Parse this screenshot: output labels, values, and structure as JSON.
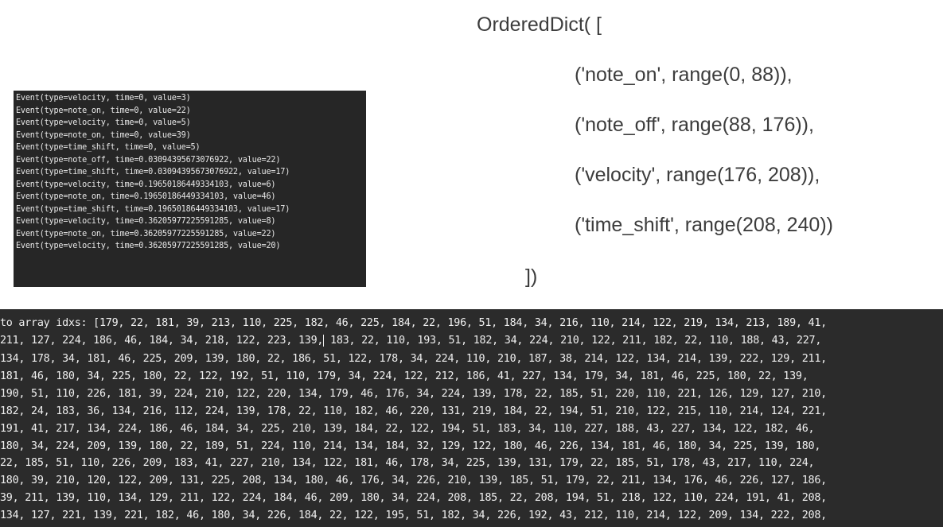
{
  "event_log": [
    "Event(type=velocity, time=0, value=3)",
    "Event(type=note_on, time=0, value=22)",
    "Event(type=velocity, time=0, value=5)",
    "Event(type=note_on, time=0, value=39)",
    "Event(type=time_shift, time=0, value=5)",
    "Event(type=note_off, time=0.03094395673076922, value=22)",
    "Event(type=time_shift, time=0.03094395673076922, value=17)",
    "Event(type=velocity, time=0.19650186449334103, value=6)",
    "Event(type=note_on, time=0.19650186449334103, value=46)",
    "Event(type=time_shift, time=0.19650186449334103, value=17)",
    "Event(type=velocity, time=0.36205977225591285, value=8)",
    "Event(type=note_on, time=0.36205977225591285, value=22)",
    "Event(type=velocity, time=0.36205977225591285, value=20)"
  ],
  "ordered_dict": {
    "open": "OrderedDict( [",
    "entries": [
      "('note_on', range(0, 88)),",
      "('note_off', range(88, 176)),",
      "('velocity', range(176, 208)),",
      "('time_shift', range(208, 240))"
    ],
    "close": "])"
  },
  "idx_panel": {
    "first_a": "to array idxs: [179, 22, 181, 39, 213, 110, 225, 182, 46, 225, 184, 22, 196, 51, 184, 34, 216, 110, 214, 122, 219, 134, 213, 189, 41, ",
    "second_a": "211, 127, 224, 186, 46, 184, 34, 218, 122, 223, 139,",
    "second_b": " 183, 22, 110, 193, 51, 182, 34, 224, 210, 122, 211, 182, 22, 110, 188, 43, 227, ",
    "lines": [
      "134, 178, 34, 181, 46, 225, 209, 139, 180, 22, 186, 51, 122, 178, 34, 224, 110, 210, 187, 38, 214, 122, 134, 214, 139, 222, 129, 211, ",
      "181, 46, 180, 34, 225, 180, 22, 122, 192, 51, 110, 179, 34, 224, 122, 212, 186, 41, 227, 134, 179, 34, 181, 46, 225, 180, 22, 139, ",
      "190, 51, 110, 226, 181, 39, 224, 210, 122, 220, 134, 179, 46, 176, 34, 224, 139, 178, 22, 185, 51, 220, 110, 221, 126, 129, 127, 210, ",
      "182, 24, 183, 36, 134, 216, 112, 224, 139, 178, 22, 110, 182, 46, 220, 131, 219, 184, 22, 194, 51, 210, 122, 215, 110, 214, 124, 221, ",
      "191, 41, 217, 134, 224, 186, 46, 184, 34, 225, 210, 139, 184, 22, 122, 194, 51, 183, 34, 110, 227, 188, 43, 227, 134, 122, 182, 46, ",
      "180, 34, 224, 209, 139, 180, 22, 189, 51, 224, 110, 214, 134, 184, 32, 129, 122, 180, 46, 226, 134, 181, 46, 180, 34, 225, 139, 180, ",
      "22, 185, 51, 110, 226, 209, 183, 41, 227, 210, 134, 122, 181, 46, 178, 34, 225, 139, 131, 179, 22, 185, 51, 178, 43, 217, 110, 224, ",
      "180, 39, 210, 120, 122, 209, 131, 225, 208, 134, 180, 46, 176, 34, 226, 210, 139, 185, 51, 179, 22, 211, 134, 176, 46, 226, 127, 186, ",
      "39, 211, 139, 110, 134, 129, 211, 122, 224, 184, 46, 209, 180, 34, 224, 208, 185, 22, 208, 194, 51, 218, 122, 110, 224, 191, 41, 208, ",
      "134, 127, 221, 139, 221, 182, 46, 180, 34, 226, 184, 22, 122, 195, 51, 182, 34, 226, 192, 43, 212, 110, 214, 122, 209, 134, 222, 208, "
    ]
  }
}
